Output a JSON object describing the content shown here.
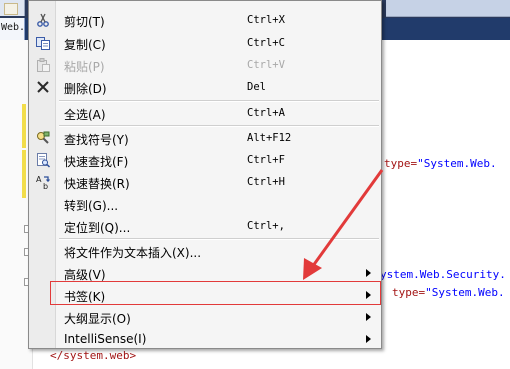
{
  "topbar": {
    "doc_tab_label": "Web."
  },
  "code_lines": [
    {
      "text_pre": "  ",
      "attr": "type=",
      "value": "\"System.Web."
    },
    {
      "text": "ystem.Web.Security."
    },
    {
      "attr": "type=",
      "value": "\"System.Web."
    },
    {
      "close_tag": "</system.web>"
    }
  ],
  "context_menu": {
    "items": [
      {
        "label": "剪切(T)",
        "shortcut": "Ctrl+X",
        "icon": "scissors-icon",
        "disabled": false
      },
      {
        "label": "复制(C)",
        "shortcut": "Ctrl+C",
        "icon": "copy-icon",
        "disabled": false
      },
      {
        "label": "粘贴(P)",
        "shortcut": "Ctrl+V",
        "icon": "paste-icon",
        "disabled": true
      },
      {
        "label": "删除(D)",
        "shortcut": "Del",
        "icon": "delete-x-icon",
        "disabled": false
      },
      {
        "label": "全选(A)",
        "shortcut": "Ctrl+A",
        "icon": "",
        "disabled": false
      },
      {
        "label": "查找符号(Y)",
        "shortcut": "Alt+F12",
        "icon": "find-symbol-icon",
        "disabled": false
      },
      {
        "label": "快速查找(F)",
        "shortcut": "Ctrl+F",
        "icon": "quick-find-icon",
        "disabled": false
      },
      {
        "label": "快速替换(R)",
        "shortcut": "Ctrl+H",
        "icon": "quick-replace-icon",
        "disabled": false
      },
      {
        "label": "转到(G)...",
        "shortcut": "",
        "icon": "",
        "disabled": false
      },
      {
        "label": "定位到(Q)...",
        "shortcut": "Ctrl+,",
        "icon": "",
        "disabled": false
      },
      {
        "label": "将文件作为文本插入(X)...",
        "shortcut": "",
        "icon": "",
        "disabled": false
      },
      {
        "label": "高级(V)",
        "shortcut": "",
        "icon": "",
        "submenu": true,
        "disabled": false
      },
      {
        "label": "书签(K)",
        "shortcut": "",
        "icon": "",
        "submenu": true,
        "disabled": false,
        "highlighted": true
      },
      {
        "label": "大纲显示(O)",
        "shortcut": "",
        "icon": "",
        "submenu": true,
        "disabled": false
      },
      {
        "label": "IntelliSense(I)",
        "shortcut": "",
        "icon": "",
        "submenu": true,
        "disabled": false
      }
    ]
  },
  "colors": {
    "highlight": "#e23a3a",
    "code_attr": "#a31515",
    "code_value": "#0000ff"
  }
}
